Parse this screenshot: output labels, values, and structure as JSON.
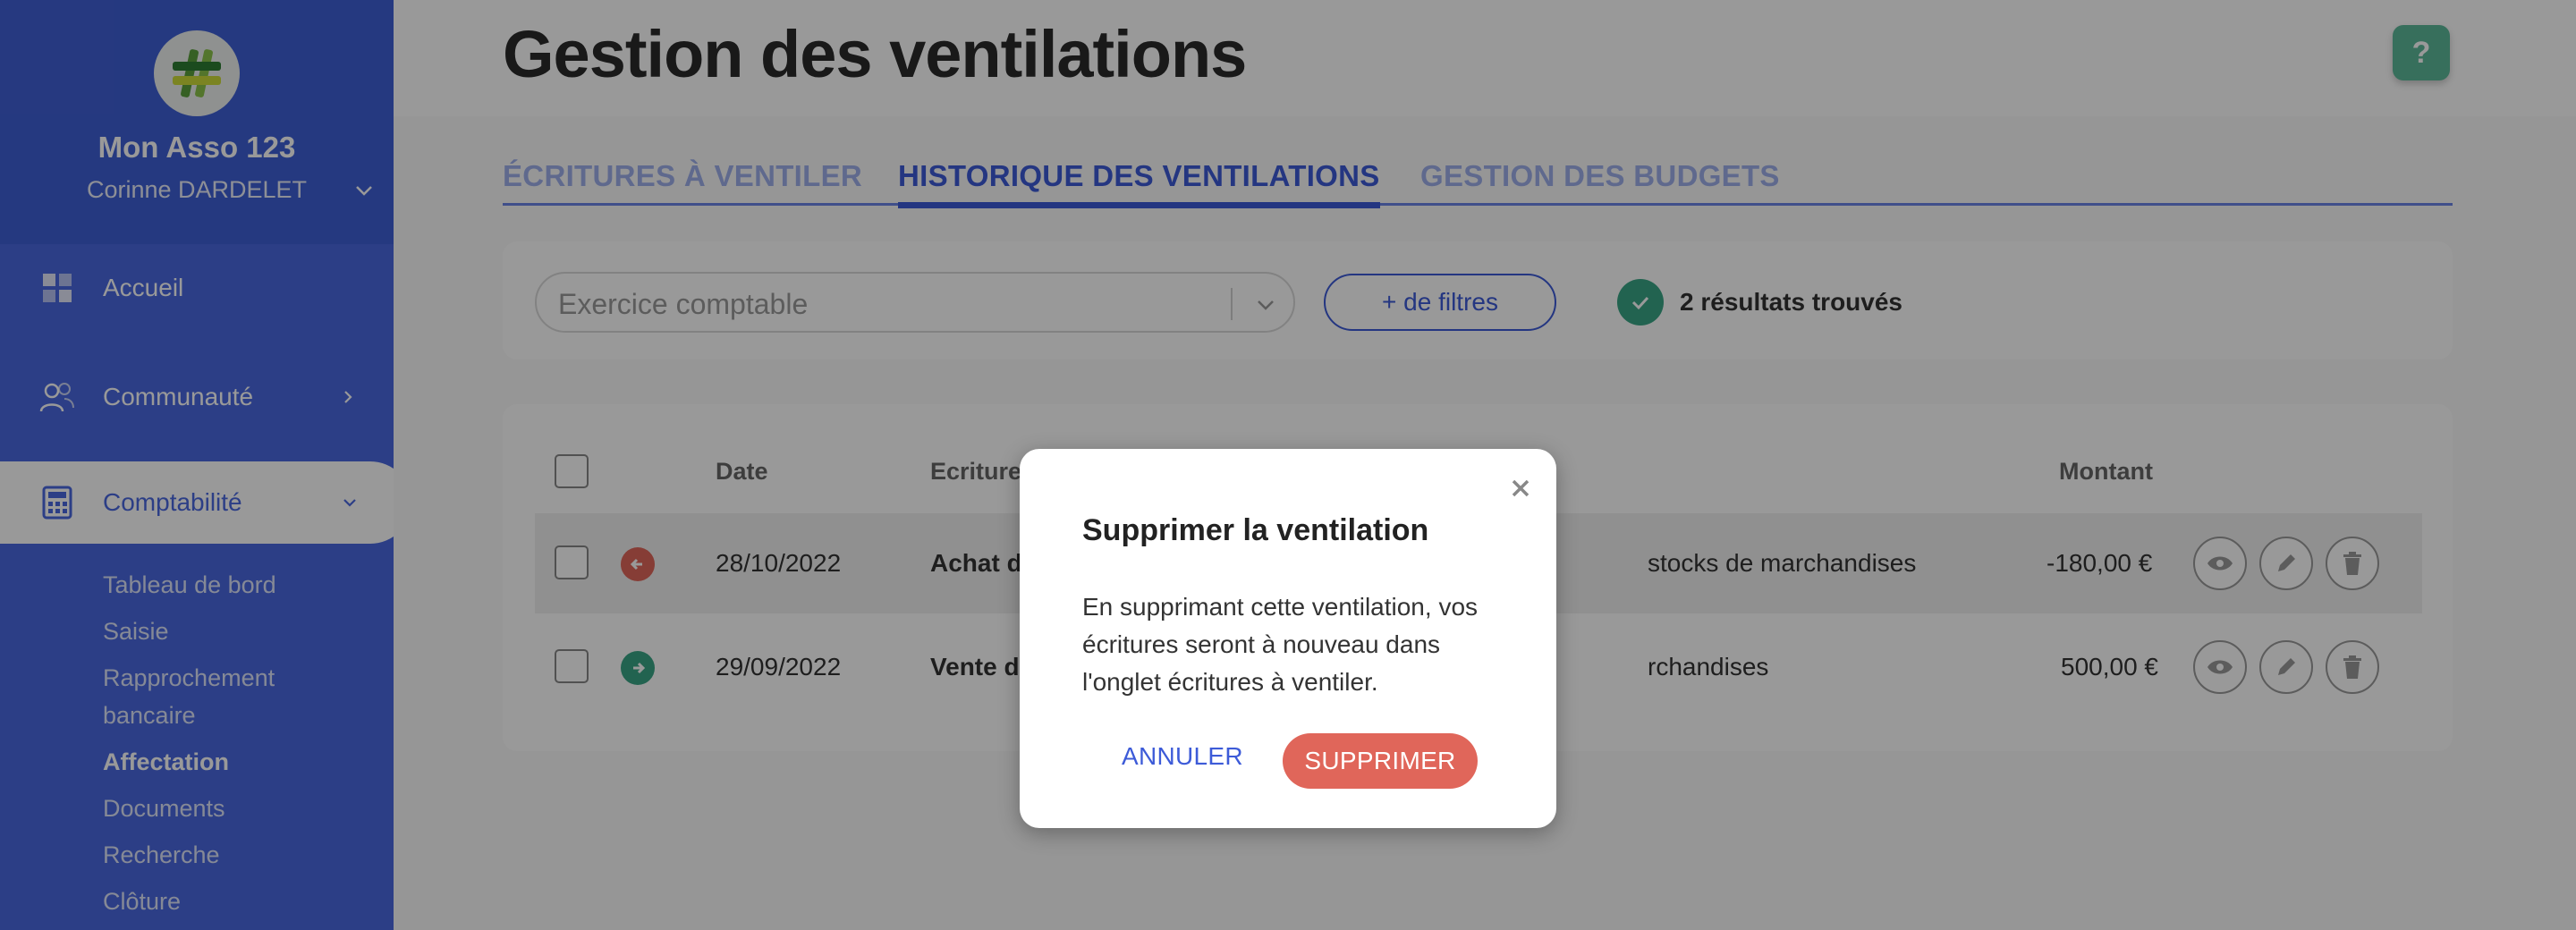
{
  "sidebar": {
    "org_name": "Mon Asso 123",
    "user_name": "Corinne DARDELET",
    "items": [
      {
        "label": "Accueil",
        "icon": "dashboard-icon"
      },
      {
        "label": "Communauté",
        "icon": "users-icon"
      },
      {
        "label": "Comptabilité",
        "icon": "calculator-icon"
      }
    ],
    "sub_items": [
      "Tableau de bord",
      "Saisie",
      "Rapprochement",
      "bancaire",
      "Affectation",
      "Documents",
      "Recherche",
      "Clôture"
    ],
    "accent_color": "#4a68e0"
  },
  "header": {
    "title": "Gestion des ventilations",
    "help_label": "?"
  },
  "tabs": [
    "ÉCRITURES À VENTILER",
    "HISTORIQUE DES VENTILATIONS",
    "GESTION DES BUDGETS"
  ],
  "filters": {
    "select_placeholder": "Exercice comptable",
    "more_filters": "+ de filtres",
    "results": "2 résultats trouvés"
  },
  "table": {
    "headers": {
      "date": "Date",
      "ecriture": "Ecriture",
      "montant": "Montant"
    },
    "rows": [
      {
        "date": "28/10/2022",
        "ecriture": "Achat d",
        "compte": "stocks de marchandises",
        "montant": "-180,00 €",
        "direction": "out",
        "color": "#e0665a"
      },
      {
        "date": "29/09/2022",
        "ecriture": "Vente d",
        "compte": "rchandises",
        "montant": "500,00 €",
        "direction": "in",
        "color": "#3aa585"
      }
    ]
  },
  "modal": {
    "title": "Supprimer la ventilation",
    "body": "En supprimant cette ventilation, vos écritures seront à nouveau dans l'onglet écritures à ventiler.",
    "cancel": "ANNULER",
    "confirm": "SUPPRIMER"
  }
}
